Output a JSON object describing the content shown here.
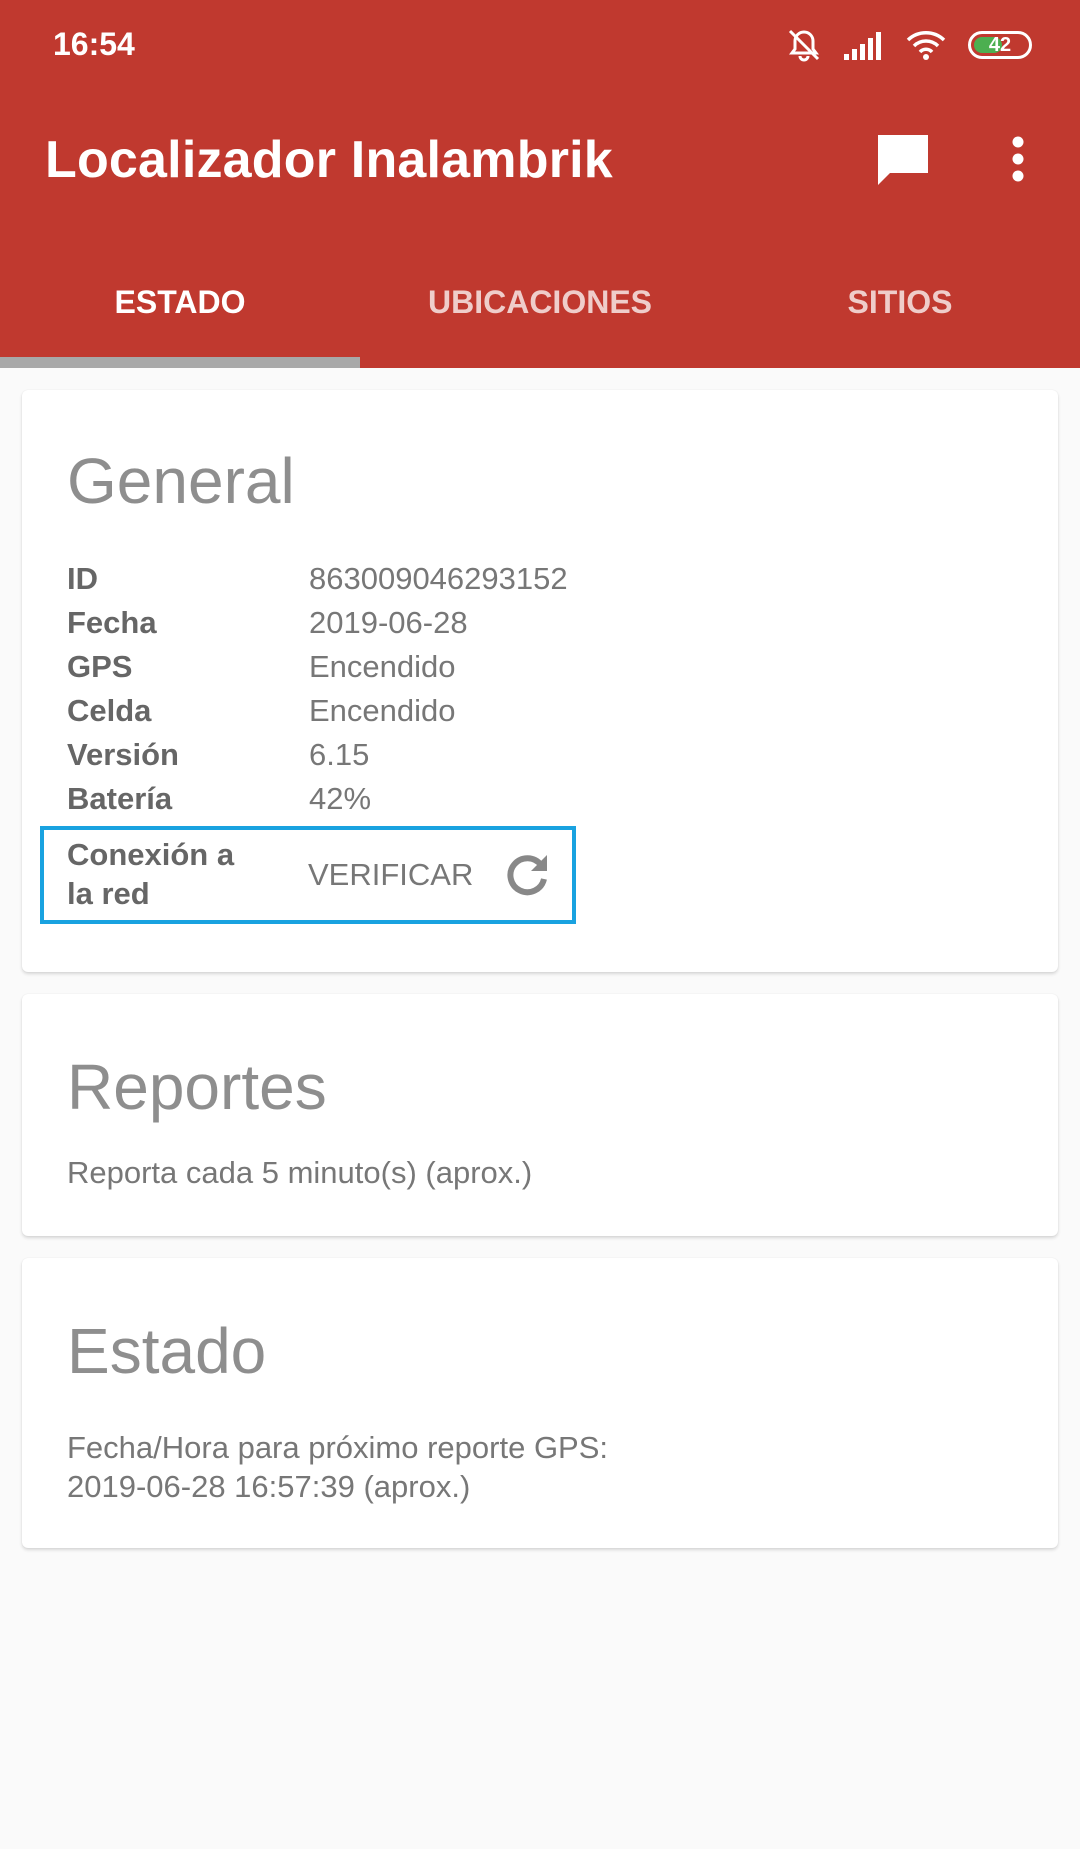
{
  "status_bar": {
    "time": "16:54",
    "icons": [
      "bell-muted-icon",
      "signal-icon",
      "wifi-icon",
      "battery-icon"
    ],
    "battery_level": "42"
  },
  "app_bar": {
    "title": "Localizador Inalambrik",
    "actions": [
      "chat-icon",
      "overflow-menu-icon"
    ],
    "color": "#c0392f"
  },
  "tabs": [
    {
      "label": "ESTADO",
      "active": true
    },
    {
      "label": "UBICACIONES",
      "active": false
    },
    {
      "label": "SITIOS",
      "active": false
    }
  ],
  "general": {
    "title": "General",
    "rows": [
      {
        "key": "ID",
        "value": "863009046293152"
      },
      {
        "key": "Fecha",
        "value": "2019-06-28"
      },
      {
        "key": "GPS",
        "value": "Encendido"
      },
      {
        "key": "Celda",
        "value": "Encendido"
      },
      {
        "key": "Versión",
        "value": "6.15"
      },
      {
        "key": "Batería",
        "value": "42%"
      }
    ],
    "network": {
      "label": "Conexión a la red",
      "button": "VERIFICAR",
      "icon": "refresh-icon",
      "highlight_color": "#19a2e0"
    }
  },
  "reportes": {
    "title": "Reportes",
    "text": "Reporta cada 5 minuto(s) (aprox.)"
  },
  "estado": {
    "title": "Estado",
    "line1": "Fecha/Hora para próximo reporte GPS:",
    "line2": "2019-06-28 16:57:39 (aprox.)"
  }
}
